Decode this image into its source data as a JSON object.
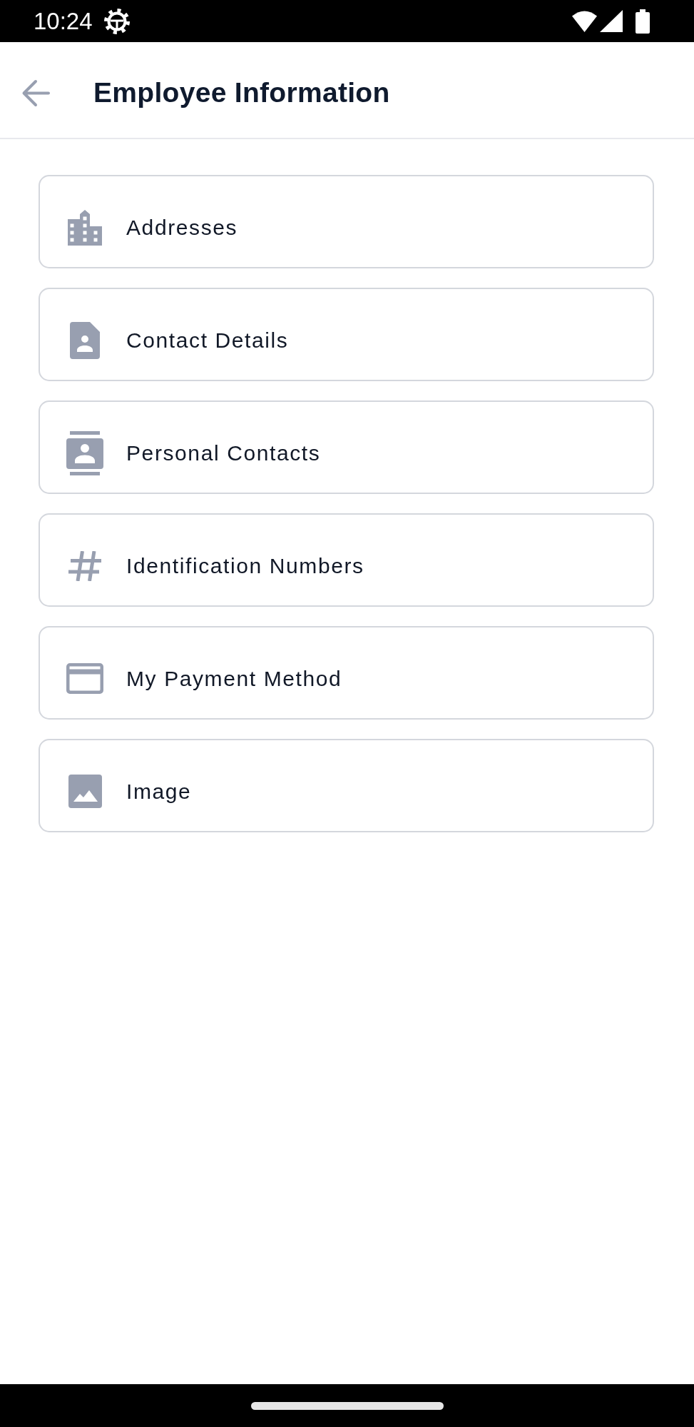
{
  "status_bar": {
    "time": "10:24"
  },
  "app_bar": {
    "title": "Employee Information"
  },
  "items": [
    {
      "kind": "building",
      "label": "Addresses"
    },
    {
      "kind": "document",
      "label": "Contact Details"
    },
    {
      "kind": "contacts",
      "label": "Personal Contacts"
    },
    {
      "kind": "hash",
      "label": "Identification Numbers"
    },
    {
      "kind": "card",
      "label": "My Payment Method"
    },
    {
      "kind": "image",
      "label": "Image"
    }
  ]
}
